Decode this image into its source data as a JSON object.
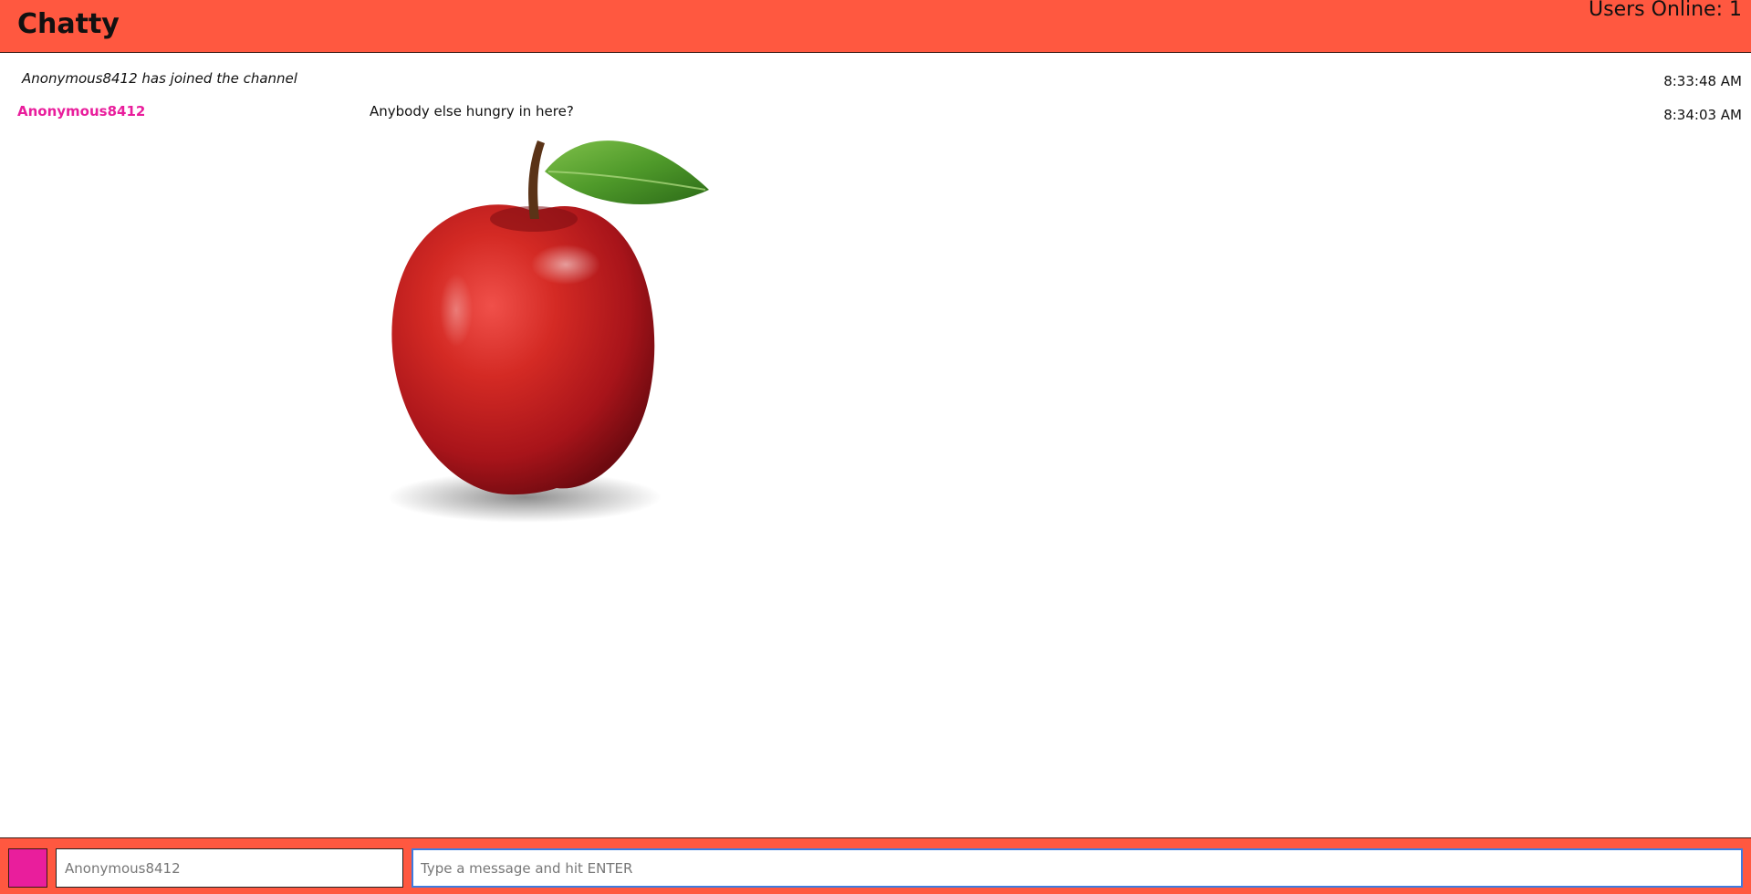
{
  "header": {
    "title": "Chatty",
    "users_online": "Users Online: 1"
  },
  "colors": {
    "bar": "#ff5840",
    "user_color": "#e91e9c",
    "focus": "#3d7be0"
  },
  "messages": {
    "system": {
      "text": "Anonymous8412 has joined the channel",
      "time": "8:33:48 AM"
    },
    "chat": {
      "username": "Anonymous8412",
      "text": "Anybody else hungry in here?",
      "time": "8:34:03 AM",
      "image_icon": "apple-image"
    }
  },
  "composer": {
    "name_placeholder": "Anonymous8412",
    "message_placeholder": "Type a message and hit ENTER"
  }
}
